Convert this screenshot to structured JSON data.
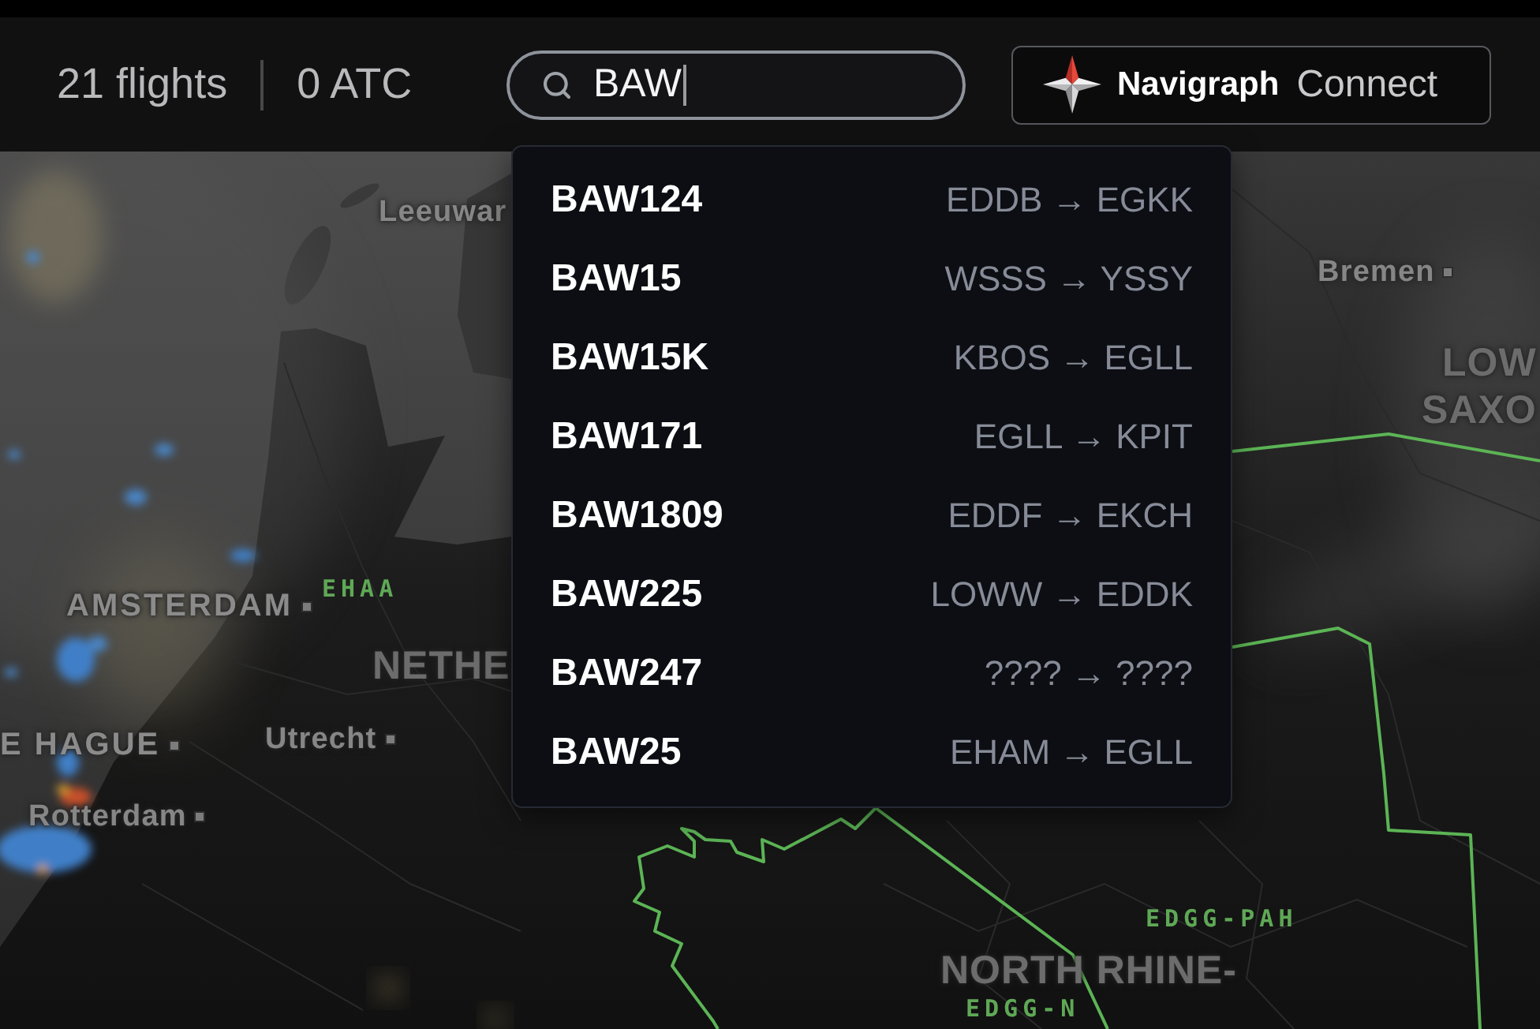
{
  "top_bar": {
    "flight_count": "21 flights",
    "atc_count": "0 ATC"
  },
  "search": {
    "value": "BAW",
    "focused": true
  },
  "connect_button": {
    "brand": "Navigraph",
    "label": "Connect"
  },
  "results": [
    {
      "callsign": "BAW124",
      "route": "EDDB → EGKK",
      "selected": false
    },
    {
      "callsign": "BAW15",
      "route": "WSSS → YSSY",
      "selected": false
    },
    {
      "callsign": "BAW15K",
      "route": "KBOS → EGLL",
      "selected": false
    },
    {
      "callsign": "BAW171",
      "route": "EGLL → KPIT",
      "selected": false
    },
    {
      "callsign": "BAW1809",
      "route": "EDDF → EKCH",
      "selected": false
    },
    {
      "callsign": "BAW225",
      "route": "LOWW → EDDK",
      "selected": false
    },
    {
      "callsign": "BAW247",
      "route": "???? → ????",
      "selected": false
    },
    {
      "callsign": "BAW25",
      "route": "EHAM → EGLL",
      "selected": false
    }
  ],
  "map": {
    "labels": [
      {
        "text": "Leeuwar",
        "kind": "city",
        "marker": false
      },
      {
        "text": "AMSTERDAM",
        "kind": "capital",
        "marker": true
      },
      {
        "text": "EHAA",
        "kind": "airspace",
        "marker": false
      },
      {
        "text": "NETHE",
        "kind": "region",
        "marker": false
      },
      {
        "text": "E HAGUE",
        "kind": "capital",
        "marker": true
      },
      {
        "text": "Utrecht",
        "kind": "city",
        "marker": true
      },
      {
        "text": "Rotterdam",
        "kind": "city",
        "marker": true
      },
      {
        "text": "Bremen",
        "kind": "city",
        "marker": true
      },
      {
        "text": "LOW",
        "kind": "region",
        "marker": false
      },
      {
        "text": "SAXO",
        "kind": "region",
        "marker": false
      },
      {
        "text": "EDGG-PAH",
        "kind": "airspace",
        "marker": false
      },
      {
        "text": "NORTH RHINE-",
        "kind": "region",
        "marker": false
      },
      {
        "text": "EDGG-N",
        "kind": "airspace",
        "marker": false
      }
    ]
  }
}
